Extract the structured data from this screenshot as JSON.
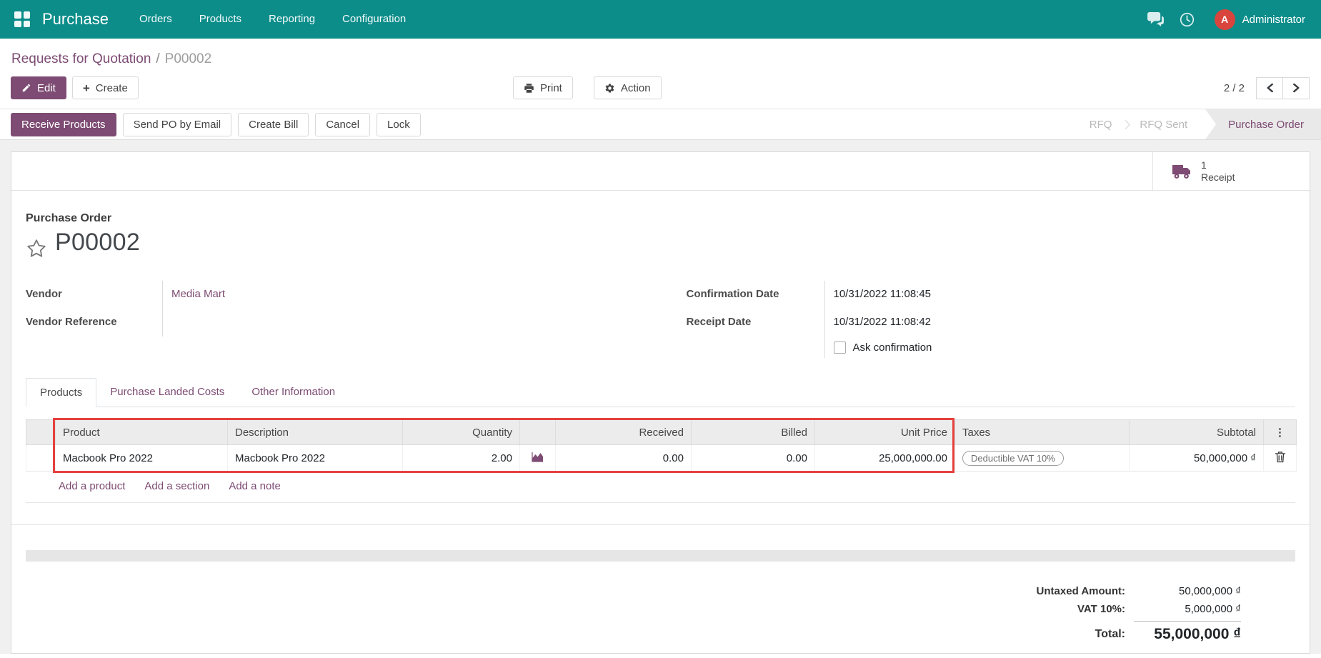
{
  "colors": {
    "navbar_bg": "#0c8d8a",
    "accent": "#7d4b73",
    "avatar_bg": "#d9443c",
    "highlight": "#e5413e"
  },
  "navbar": {
    "brand": "Purchase",
    "menus": [
      {
        "label": "Orders"
      },
      {
        "label": "Products"
      },
      {
        "label": "Reporting"
      },
      {
        "label": "Configuration"
      }
    ],
    "user": {
      "name": "Administrator",
      "avatar_initial": "A"
    }
  },
  "breadcrumb": {
    "parent": "Requests for Quotation",
    "separator": "/",
    "current": "P00002"
  },
  "control_panel": {
    "edit_label": "Edit",
    "create_label": "Create",
    "print_label": "Print",
    "action_label": "Action",
    "pager": "2 / 2"
  },
  "icons": {
    "plus": "+",
    "options": "⋮"
  },
  "statusbar": {
    "buttons": [
      {
        "label": "Receive Products"
      },
      {
        "label": "Send PO by Email"
      },
      {
        "label": "Create Bill"
      },
      {
        "label": "Cancel"
      },
      {
        "label": "Lock"
      }
    ],
    "states": [
      {
        "label": "RFQ"
      },
      {
        "label": "RFQ Sent"
      },
      {
        "label": "Purchase Order"
      }
    ]
  },
  "smart_button": {
    "count": "1",
    "label": "Receipt"
  },
  "form": {
    "type_label": "Purchase Order",
    "title": "P00002",
    "vendor_label": "Vendor",
    "vendor_value": "Media Mart",
    "vendor_ref_label": "Vendor Reference",
    "vendor_ref_value": "",
    "confirmation_date_label": "Confirmation Date",
    "confirmation_date_value": "10/31/2022 11:08:45",
    "receipt_date_label": "Receipt Date",
    "receipt_date_value": "10/31/2022 11:08:42",
    "checkbox_label": "Ask confirmation"
  },
  "tabs": [
    {
      "label": "Products"
    },
    {
      "label": "Purchase Landed Costs"
    },
    {
      "label": "Other Information"
    }
  ],
  "lines_table": {
    "headers": {
      "product": "Product",
      "description": "Description",
      "quantity": "Quantity",
      "received": "Received",
      "billed": "Billed",
      "unit_price": "Unit Price",
      "taxes": "Taxes",
      "subtotal": "Subtotal"
    },
    "rows": [
      {
        "product": "Macbook Pro 2022",
        "description": "Macbook Pro 2022",
        "quantity": "2.00",
        "received": "0.00",
        "billed": "0.00",
        "unit_price": "25,000,000.00",
        "taxes": "Deductible VAT 10%",
        "subtotal": "50,000,000 ₫"
      }
    ],
    "footer_links": [
      {
        "label": "Add a product"
      },
      {
        "label": "Add a section"
      },
      {
        "label": "Add a note"
      }
    ]
  },
  "totals": {
    "untaxed_label": "Untaxed Amount:",
    "untaxed_value": "50,000,000 ₫",
    "tax_label": "VAT 10%:",
    "tax_value": "5,000,000 ₫",
    "total_label": "Total:",
    "total_value": "55,000,000 ₫"
  }
}
